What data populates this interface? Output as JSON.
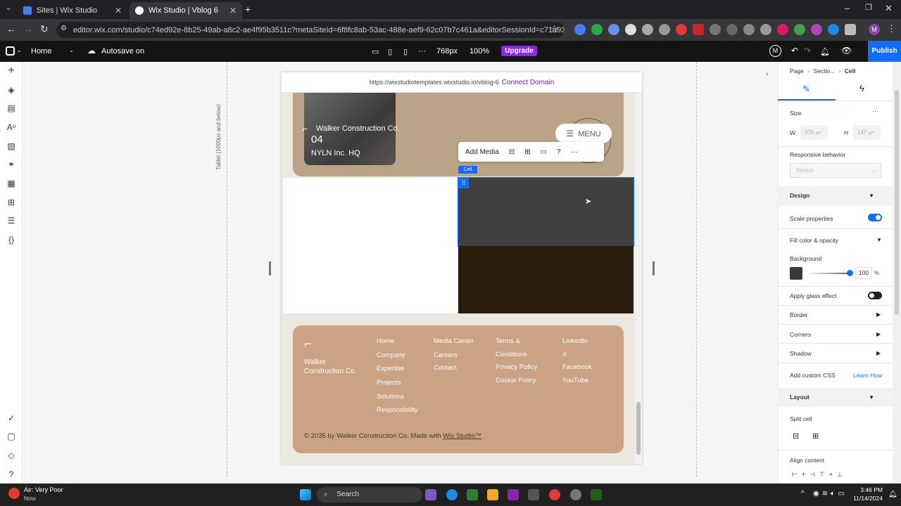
{
  "browser": {
    "tabs": [
      {
        "title": "Sites | Wix Studio",
        "active": false
      },
      {
        "title": "Wix Studio | Vblog 6",
        "active": true
      }
    ],
    "url": "editor.wix.com/studio/c74ed92e-8b25-49ab-a8c2-ae4f95b3511c?metaSiteId=6f8fc8ab-53ac-488e-aef9-62c07b7c461a&editorSessionId=c71a93b4-75dc-47b6-8..."
  },
  "editor": {
    "page": "Home",
    "autosave": "Autosave on",
    "breakpoint": "768px",
    "zoom": "100%",
    "upgrade": "Upgrade",
    "publish": "Publish",
    "account_initial": "M",
    "breakpoint_label": "Tablet (1000px and below)"
  },
  "site": {
    "live_url": "https://wixstudiotemplates.wixstudio.io/vblog-6",
    "connect_domain": "Connect Domain",
    "hero": {
      "company": "Walker Construction Co.",
      "number": "04",
      "project": "NYLN Inc. HQ",
      "menu": "MENU"
    },
    "context_toolbar": {
      "add_media": "Add Media"
    },
    "cell_tag": "Cell",
    "footer": {
      "company_line1": "Walker",
      "company_line2": "Construction Co.",
      "col1": [
        "Home",
        "Company",
        "Expertise",
        "Projects",
        "Solutions",
        "Responsibility"
      ],
      "col2": [
        "Media Center",
        "Careers",
        "Contact"
      ],
      "col3": [
        "Terms &",
        "Conditions",
        "Privacy Policy",
        "Cookie Policy"
      ],
      "col4": [
        "LinkedIn",
        "X",
        "Facebook",
        "YouTube"
      ],
      "copyright_prefix": "© 2035 by Walker Construction Co. Made with ",
      "copyright_link": "Wix Studio™"
    }
  },
  "inspector": {
    "breadcrumb": [
      "Page",
      "Sectio...",
      "Cell"
    ],
    "size": "Size",
    "w_label": "W",
    "w_value": "376",
    "w_unit": "px*",
    "h_label": "H",
    "h_value": "147",
    "h_unit": "px*",
    "responsive_behavior": "Responsive behavior",
    "responsive_value": "Stretch",
    "design": "Design",
    "scale_properties": "Scale properties",
    "scale_properties_on": true,
    "fill_color_opacity": "Fill color & opacity",
    "background": "Background",
    "background_color": "#3a3a3a",
    "opacity": "100",
    "opacity_unit": "%",
    "apply_glass": "Apply glass effect",
    "apply_glass_on": false,
    "border": "Border",
    "corners": "Corners",
    "shadow": "Shadow",
    "custom_css": "Add custom CSS",
    "learn_how": "Learn How",
    "layout": "Layout",
    "split_cell": "Split cell",
    "align_content": "Align content"
  },
  "taskbar": {
    "weather_title": "Air: Very Poor",
    "weather_sub": "Now",
    "search": "Search",
    "time": "3:46 PM",
    "date": "11/14/2024"
  },
  "colors": {
    "accent": "#116dff",
    "upgrade": "#8a2be2",
    "hero": "#b9a487",
    "footer": "#c9a384"
  }
}
